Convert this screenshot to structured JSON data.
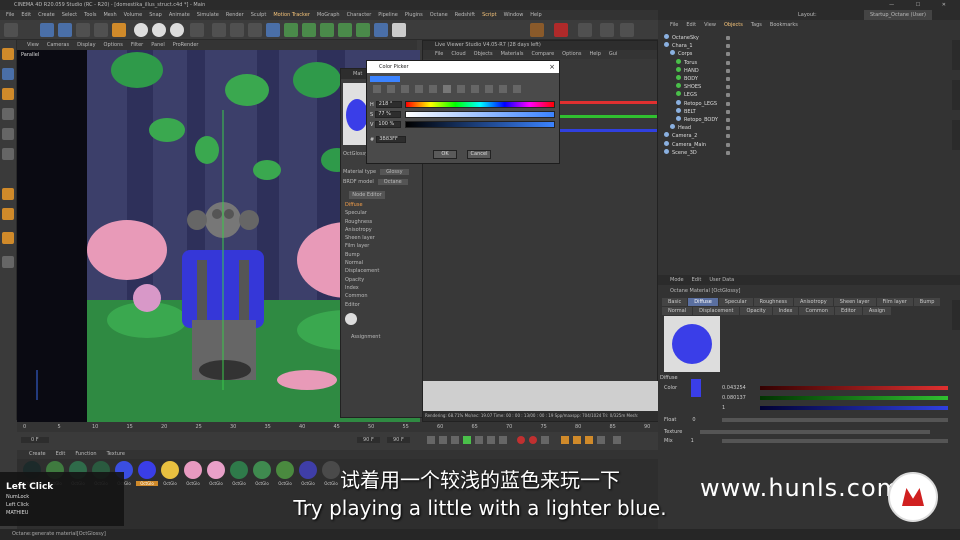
{
  "window": {
    "title": "CINEMA 4D R20.059 Studio (RC - R20) - [domestika_illus_struct.c4d *] - Main",
    "controls": "— ☐ ✕"
  },
  "menubar": [
    "File",
    "Edit",
    "Create",
    "Select",
    "Tools",
    "Mesh",
    "Volume",
    "Snap",
    "Animate",
    "Simulate",
    "Render",
    "Sculpt",
    "Motion Tracker",
    "MoGraph",
    "Character",
    "Pipeline",
    "Plugins",
    "Octane",
    "Redshift",
    "Script",
    "Window",
    "Help"
  ],
  "viewport": {
    "menu": [
      "View",
      "Cameras",
      "Display",
      "Options",
      "Filter",
      "Panel",
      "ProRender"
    ],
    "label": "Parallel",
    "grid_spacing": "Grid Spacing : 100 cm"
  },
  "material_editor": {
    "title": "Mat",
    "name": "OctGlossy",
    "material_type_label": "Material type",
    "material_type": "Glossy",
    "brdf_label": "BRDF model",
    "brdf": "Octane",
    "node_editor": "Node Editor",
    "channels": [
      "Diffuse",
      "Specular",
      "Roughness",
      "Anisotropy",
      "Sheen layer",
      "Film layer",
      "Bump",
      "Normal",
      "Displacement",
      "Opacity",
      "Index",
      "Common",
      "Editor"
    ],
    "assignment": "Assignment"
  },
  "live_viewer": {
    "title": "Live Viewer Studio V4.05-R7 (28 days left)",
    "menu": [
      "File",
      "Cloud",
      "Objects",
      "Materials",
      "Compare",
      "Options",
      "Help",
      "Gui"
    ],
    "status": "Rendering: 68.71%   Ms/sec: 19.07   Time: 00 : 00 : 13/00 : 00 : 19   Spp/maxspp: 704/1024   Tri: 0/325m   Mesh:"
  },
  "color_picker": {
    "title": "Color Picker",
    "h_label": "H",
    "h_value": "218 °",
    "s_label": "S",
    "s_value": "77 %",
    "v_label": "V",
    "v_value": "100 %",
    "hex_label": "#",
    "hex_value": "3B83FF",
    "swatch_color": "#3b83ff",
    "ok": "OK",
    "cancel": "Cancel"
  },
  "timeline": {
    "ticks": [
      "0",
      "5",
      "10",
      "15",
      "20",
      "25",
      "30",
      "35",
      "40",
      "45",
      "50",
      "55",
      "60",
      "65",
      "70",
      "75",
      "80",
      "85",
      "90"
    ],
    "frame_start": "0 F",
    "frame_end": "90 F",
    "frame_end2": "90 F"
  },
  "material_shelf": {
    "menu": [
      "Create",
      "Edit",
      "Function",
      "Texture"
    ],
    "names": [
      "OctGlo",
      "OctGlo",
      "OctGlo",
      "OctGlo",
      "OctGlo",
      "OctGlo",
      "OctGlo",
      "OctGlo",
      "OctGlo",
      "OctGlo",
      "OctGlo",
      "OctGlo",
      "OctGlo",
      "OctGlo"
    ],
    "ball_colors": [
      "#1c2a2a",
      "#3f7a3f",
      "#2f6b4a",
      "#2a5a3f",
      "#3a4ee0",
      "#3a3ee8",
      "#e8c040",
      "#e89ac0",
      "#e8a0c8",
      "#2f7a4a",
      "#3f8a4f",
      "#4a8a3f",
      "#3f3ea8",
      "#4a4a4a"
    ]
  },
  "status_bar": "Octane:generate material[OctGlossy]",
  "key_overlay": {
    "title": "Left Click",
    "line1": "NumLock",
    "line2": "Left Click",
    "line3": "MATHIEU"
  },
  "right_panel": {
    "layout_label": "Layout:",
    "layout_value": "Startup_Octane (User)",
    "object_menu": [
      "File",
      "Edit",
      "View",
      "Objects",
      "Tags",
      "Bookmarks"
    ],
    "objects": [
      "OctaneSky",
      "Chara_1",
      "Corps",
      "Torus",
      "HAND",
      "BODY",
      "SHOES",
      "LEGS",
      "Retopo_LEGS",
      "BELT",
      "Retopo_BODY",
      "Head",
      "Camera_2",
      "Camera_Main",
      "Scene_3D"
    ],
    "attr_menu": [
      "Mode",
      "Edit",
      "User Data"
    ],
    "attr_name": "Octane Material [OctGlossy]",
    "tabs_row1": [
      "Basic",
      "Diffuse",
      "Specular",
      "Roughness",
      "Anisotropy",
      "Sheen layer",
      "Film layer",
      "Bump"
    ],
    "tabs_row2": [
      "Normal",
      "Displacement",
      "Opacity",
      "Index",
      "Common",
      "Editor",
      "Assign"
    ],
    "active_tab": "Diffuse",
    "section": "Diffuse",
    "color_label": "Color",
    "r_value": "0.043254",
    "g_value": "0.080137",
    "b_value": "1",
    "float_label": "Float",
    "float_value": "0",
    "texture_label": "Texture",
    "mix_label": "Mix",
    "mix_value": "1"
  },
  "subtitles": {
    "cn": "试着用一个较浅的蓝色来玩一下",
    "en": "Try playing a little with a lighter blue."
  },
  "watermark": "www.hunls.com"
}
